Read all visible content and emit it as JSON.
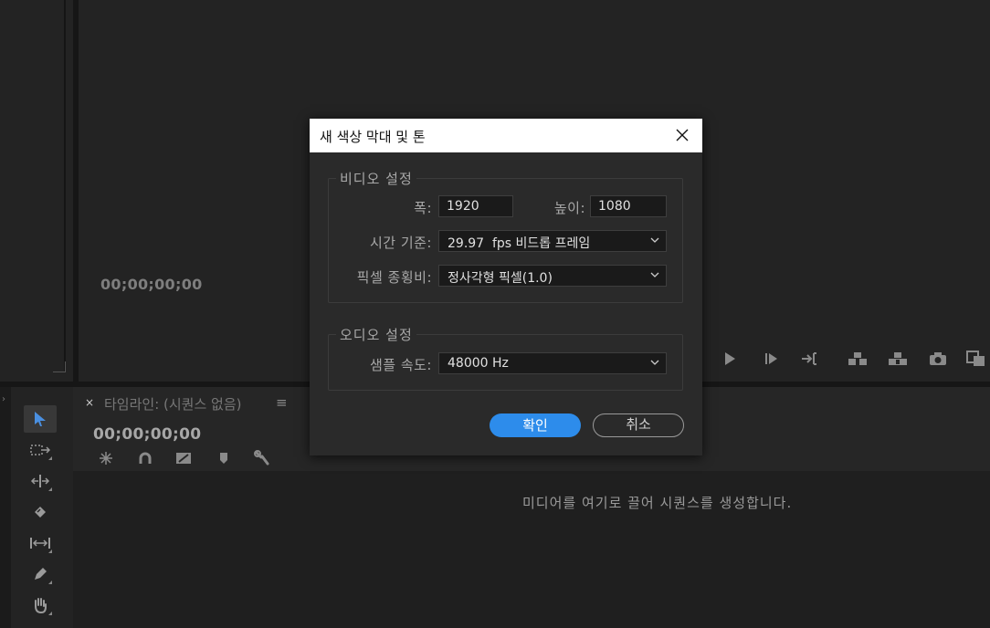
{
  "monitor": {
    "timecode": "00;00;00;00"
  },
  "timeline": {
    "close_glyph": "×",
    "title": "타임라인: (시퀀스 없음)",
    "menu_glyph": "≡",
    "timecode": "00;00;00;00",
    "empty_hint": "미디어를 여기로 끌어 시퀀스를 생성합니다."
  },
  "dialog": {
    "title": "새 색상 막대 및 톤",
    "video_settings": {
      "legend": "비디오 설정",
      "width_label": "폭:",
      "width_value": "1920",
      "height_label": "높이:",
      "height_value": "1080",
      "timebase_label": "시간 기준:",
      "timebase_value": "29.97  fps 비드롭 프레임",
      "par_label": "픽셀 종횡비:",
      "par_value": "정사각형 픽셀(1.0)"
    },
    "audio_settings": {
      "legend": "오디오 설정",
      "sample_rate_label": "샘플 속도:",
      "sample_rate_value": "48000 Hz"
    },
    "ok_label": "확인",
    "cancel_label": "취소"
  },
  "icons": {
    "play": "play-icon",
    "step_forward": "step-forward-icon",
    "go_to_out": "go-to-out-icon",
    "insert": "insert-icon",
    "overwrite": "overwrite-icon",
    "export_frame": "camera-icon",
    "compare": "compare-icon"
  }
}
